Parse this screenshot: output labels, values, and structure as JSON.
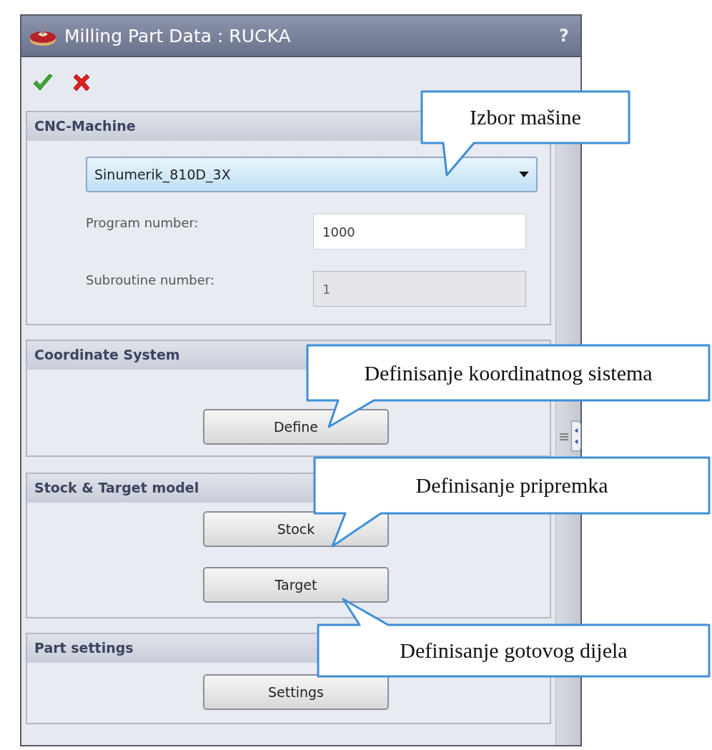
{
  "window": {
    "title": "Milling Part Data : RUCKA",
    "help": "?"
  },
  "sections": [
    {
      "title": "CNC-Machine",
      "kind": "machine",
      "machine": {
        "value": "Sinumerik_810D_3X"
      },
      "fields": [
        {
          "label": "Program number:",
          "value": "1000",
          "disabled": false
        },
        {
          "label": "Subroutine number:",
          "value": "1",
          "disabled": true
        }
      ]
    },
    {
      "title": "Coordinate System",
      "kind": "buttons",
      "buttons": [
        "Define"
      ]
    },
    {
      "title": "Stock & Target model",
      "kind": "buttons",
      "buttons": [
        "Stock",
        "Target"
      ]
    },
    {
      "title": "Part settings",
      "kind": "buttons",
      "buttons": [
        "Settings"
      ]
    }
  ],
  "callouts": [
    "Izbor mašine",
    "Definisanje koordinatnog sistema",
    "Definisanje pripremka",
    "Definisanje gotovog dijela"
  ]
}
